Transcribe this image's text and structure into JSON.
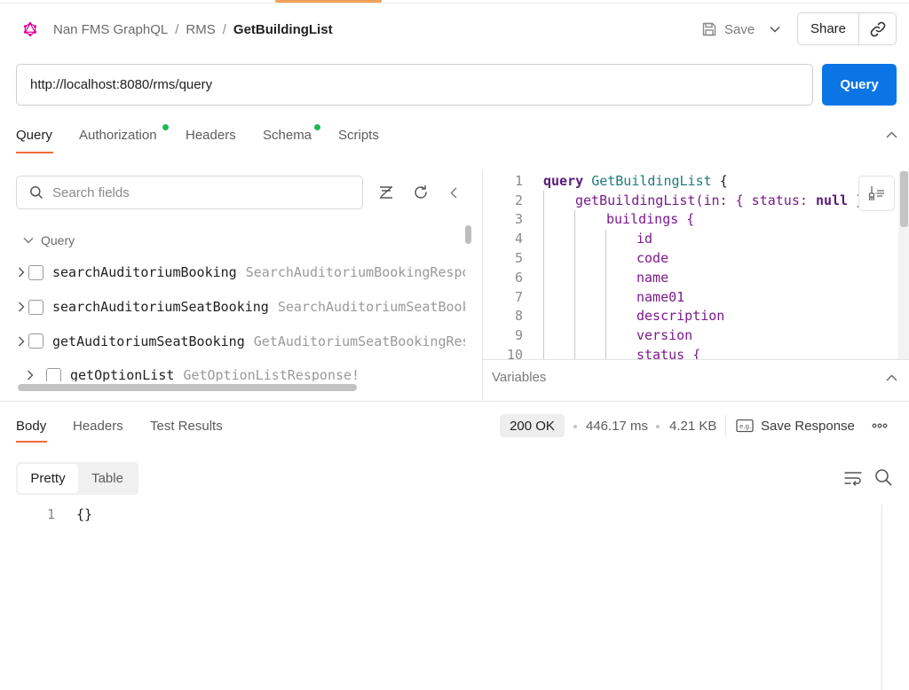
{
  "breadcrumb": {
    "items": [
      "Nan FMS GraphQL",
      "RMS"
    ],
    "separator": "/",
    "current": "GetBuildingList"
  },
  "toolbar": {
    "save_label": "Save",
    "share_label": "Share"
  },
  "request": {
    "url": "http://localhost:8080/rms/query",
    "send_label": "Query"
  },
  "tabs": {
    "query": "Query",
    "authorization": "Authorization",
    "headers": "Headers",
    "schema": "Schema",
    "scripts": "Scripts"
  },
  "explorer": {
    "search_placeholder": "Search fields",
    "root_label": "Query",
    "fields": [
      {
        "name": "searchAuditoriumBooking",
        "type": "SearchAuditoriumBookingResponse!"
      },
      {
        "name": "searchAuditoriumSeatBooking",
        "type": "SearchAuditoriumSeatBookingResponse!"
      },
      {
        "name": "getAuditoriumSeatBooking",
        "type": "GetAuditoriumSeatBookingResponse!"
      },
      {
        "name": "getOptionList",
        "type": "GetOptionListResponse!"
      }
    ]
  },
  "editor": {
    "line_numbers": [
      "1",
      "2",
      "3",
      "4",
      "5",
      "6",
      "7",
      "8",
      "9",
      "10"
    ],
    "lines": {
      "l1_kw": "query",
      "l1_op": "GetBuildingList",
      "l1_punc": "{",
      "l2_fn": "getBuildingList",
      "l2_rest": "(in: { status: ",
      "l2_null": "null",
      "l2_end": " })",
      "l3": "buildings {",
      "l4": "id",
      "l5": "code",
      "l6": "name",
      "l7": "name01",
      "l8": "description",
      "l9": "version",
      "l10": "status {"
    },
    "variables_label": "Variables"
  },
  "response": {
    "tabs": {
      "body": "Body",
      "headers": "Headers",
      "tests": "Test Results"
    },
    "status": "200 OK",
    "time": "446.17 ms",
    "size": "4.21 KB",
    "save_label": "Save Response",
    "view_modes": {
      "pretty": "Pretty",
      "table": "Table"
    },
    "line_number": "1",
    "body_text": "{}"
  },
  "colors": {
    "accent": "#f26b3a",
    "primary": "#0b75e6",
    "status_dot": "#1db954",
    "graphql": "#e10098"
  }
}
